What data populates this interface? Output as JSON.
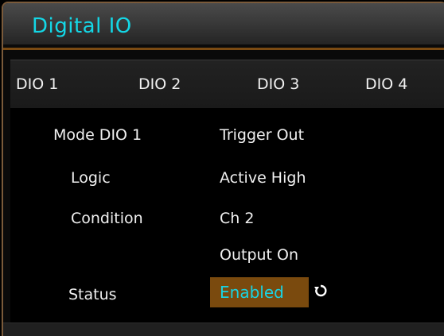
{
  "window": {
    "title": "Digital IO"
  },
  "tabs": [
    {
      "label": "DIO 1"
    },
    {
      "label": "DIO 2"
    },
    {
      "label": "DIO 3"
    },
    {
      "label": "DIO 4"
    }
  ],
  "settings": {
    "mode": {
      "label": "Mode DIO 1",
      "value": "Trigger Out"
    },
    "logic": {
      "label": "Logic",
      "value": "Active High"
    },
    "condition": {
      "label": "Condition",
      "value_line1": "Ch 2",
      "value_line2": "Output On"
    },
    "status": {
      "label": "Status",
      "value": "Enabled"
    }
  },
  "icons": {
    "status_toggle": "cycle-icon"
  },
  "colors": {
    "accent_cyan": "#14d7e6",
    "highlight_orange": "#7a4a0e",
    "frame_brown": "#7a5a3a"
  }
}
